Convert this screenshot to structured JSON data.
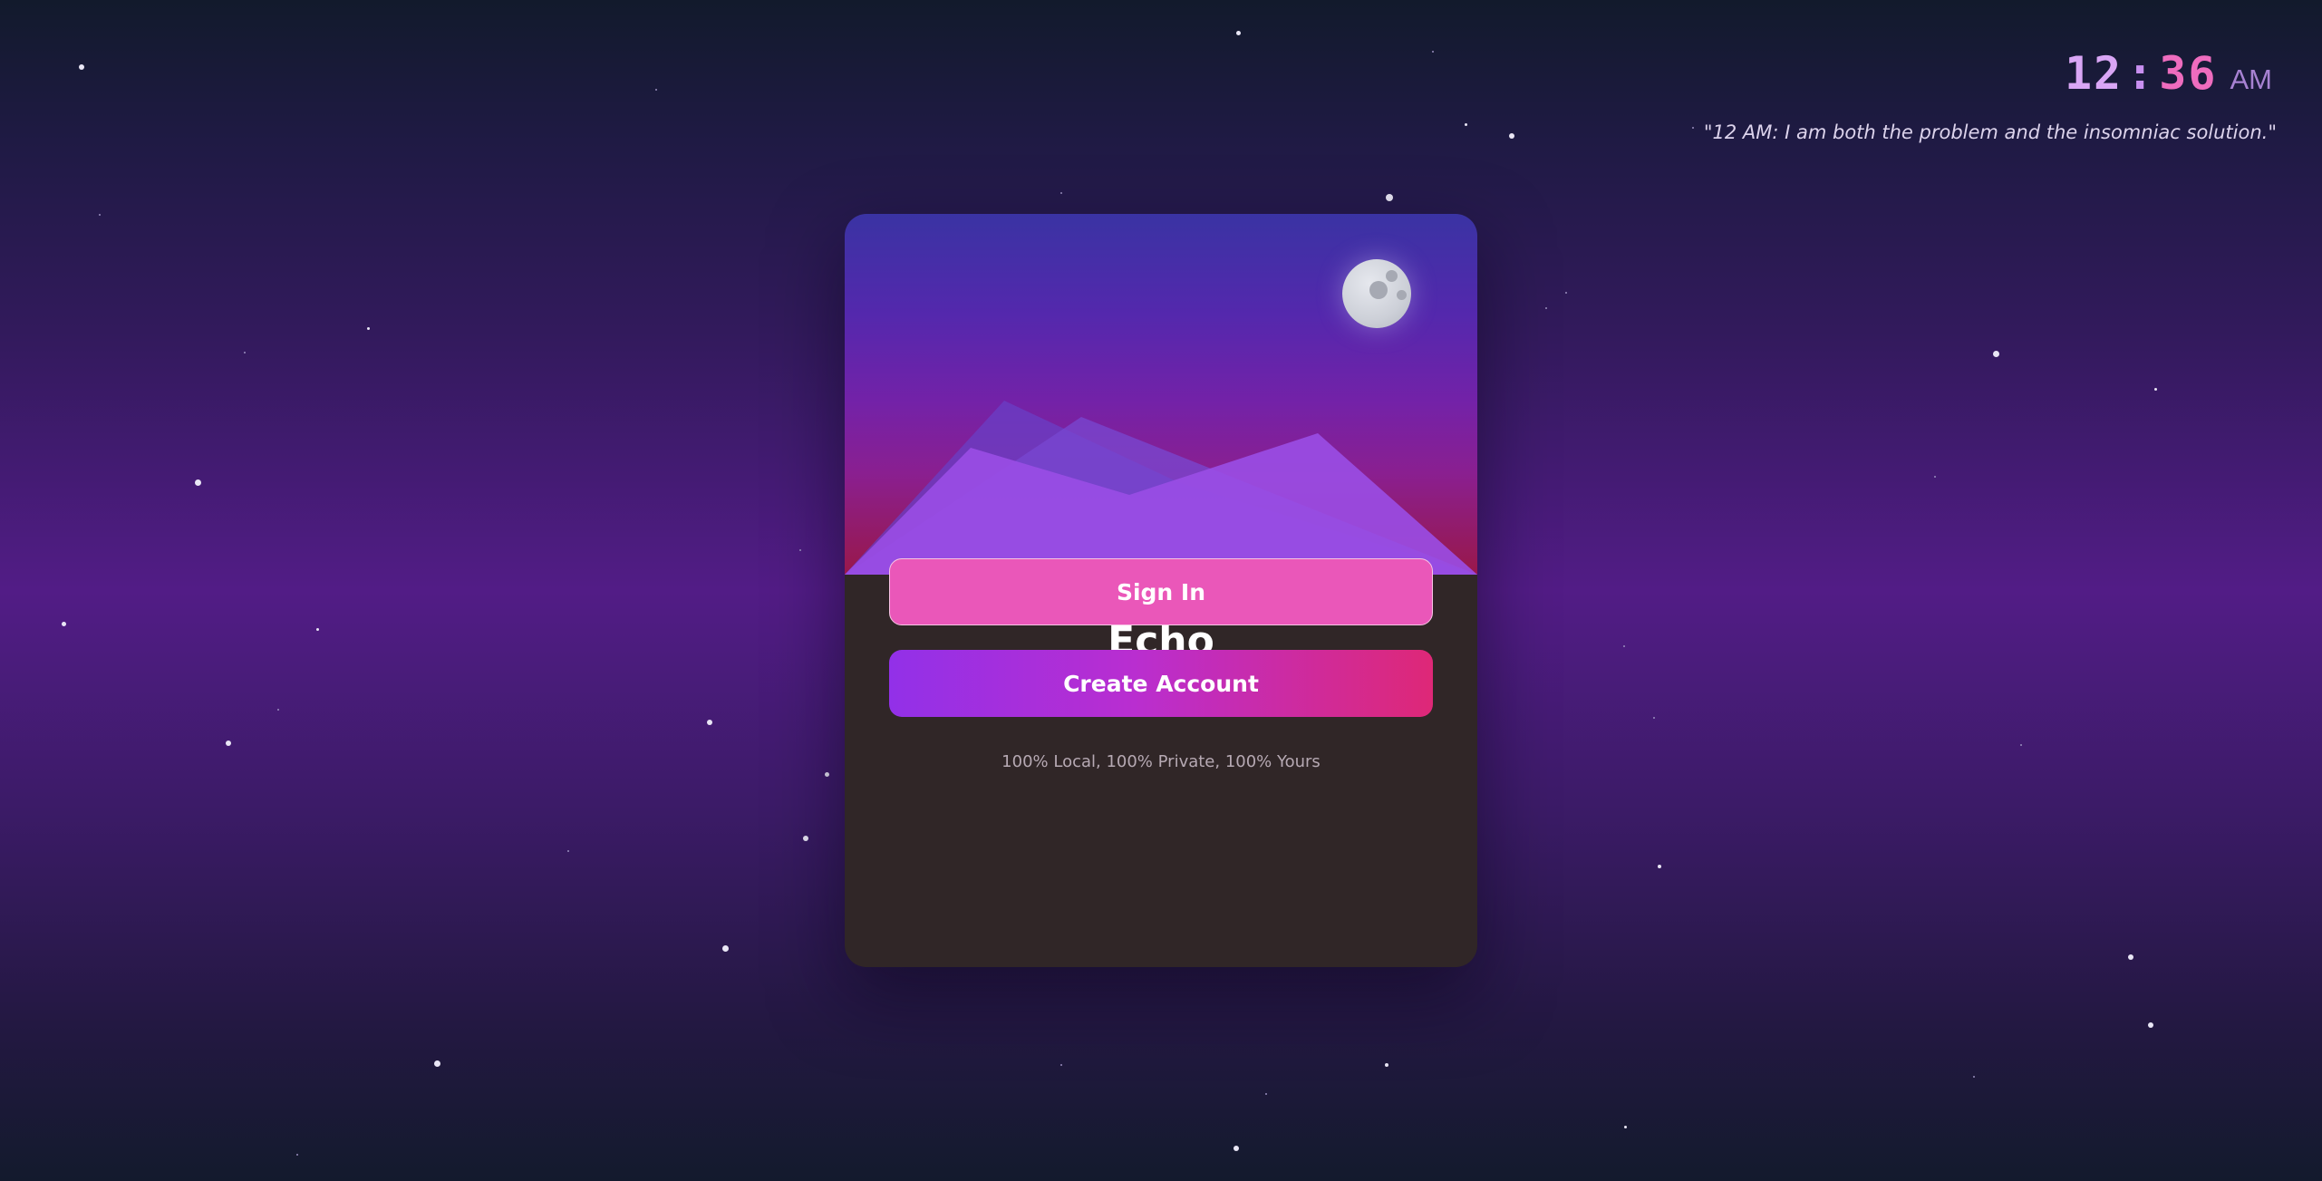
{
  "clock": {
    "hours": "12",
    "separator": ":",
    "minutes": "36",
    "period": "AM"
  },
  "quote": "\"12 AM: I am both the problem and the insomniac solution.\"",
  "card": {
    "title": "Echo",
    "sign_in_label": "Sign In",
    "create_account_label": "Create Account",
    "footnote": "100% Local, 100% Private, 100% Yours"
  },
  "colors": {
    "clock_hours": "#d9a6f5",
    "clock_minutes": "#ee6cbe",
    "sign_in_button": "#ea57b9",
    "create_account_gradient_start": "#9230e8",
    "create_account_gradient_end": "#de2877",
    "card_body": "#302627"
  }
}
